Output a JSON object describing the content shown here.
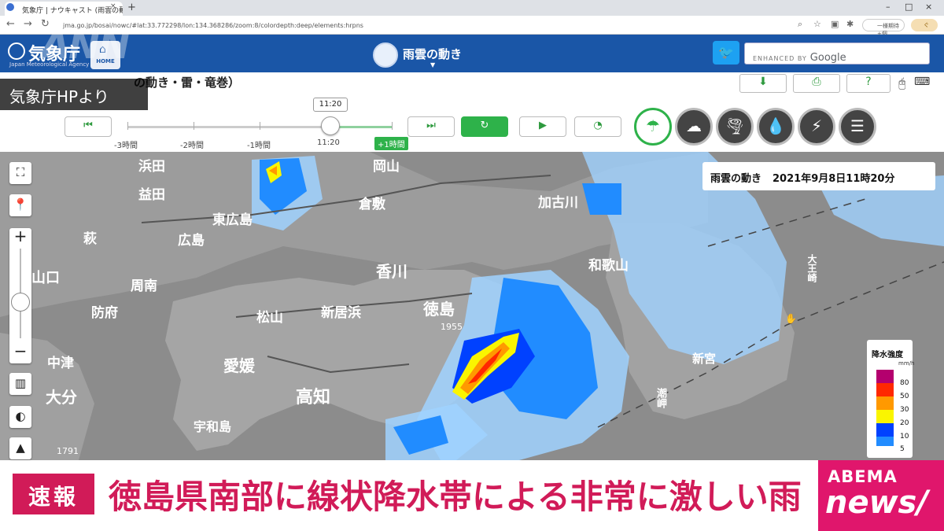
{
  "browser": {
    "tab_title": "気象庁 | ナウキャスト (雨雲の動き",
    "tab_close": "×",
    "new_tab": "+",
    "url": "jma.go.jp/bosai/nowc/#lat:33.772298/lon:134.368286/zoom:8/colordepth:deep/elements:hrpns",
    "window_controls": [
      "–",
      "□",
      "×"
    ],
    "ext1_label": "一様期待+個",
    "ext2_label": "ぐ"
  },
  "jma": {
    "title": "気象庁",
    "subtitle": "Japan Meteorological Agency",
    "home_label": "HOME",
    "nowcast_title": "雨雲の動き",
    "nowcast_caret": "▼",
    "search_enhanced": "ENHANCED BY",
    "search_google": "Google"
  },
  "controls": {
    "heading": "の動き・雷・竜巻）",
    "current_time": "11:20",
    "time_labels": [
      "-3時間",
      "-2時間",
      "-1時間",
      "11:20",
      "+1時間"
    ],
    "buttons": {
      "first": "⏮",
      "last": "⏭",
      "refresh": "↻",
      "play": "▶",
      "speed": "◔",
      "download": "⬇",
      "print": "⎙",
      "help": "?"
    }
  },
  "layers": [
    "雨雲",
    "雷",
    "竜巻",
    "降水",
    "雷活動",
    "強風"
  ],
  "map": {
    "timestamp_title": "雨雲の動き",
    "timestamp_value": "2021年9月8日11時20分",
    "labels": [
      {
        "text": "浜田"
      },
      {
        "text": "岡山"
      },
      {
        "text": "倉敷"
      },
      {
        "text": "加古川"
      },
      {
        "text": "益田"
      },
      {
        "text": "東広島"
      },
      {
        "text": "萩"
      },
      {
        "text": "広島"
      },
      {
        "text": "山口"
      },
      {
        "text": "周南"
      },
      {
        "text": "防府"
      },
      {
        "text": "香川"
      },
      {
        "text": "徳島"
      },
      {
        "text": "和歌山"
      },
      {
        "text": "松山"
      },
      {
        "text": "新居浜"
      },
      {
        "text": "愛媛"
      },
      {
        "text": "高知"
      },
      {
        "text": "中津"
      },
      {
        "text": "大分"
      },
      {
        "text": "宇和島"
      },
      {
        "text": "大王崎"
      },
      {
        "text": "新宮"
      },
      {
        "text": "潮岬"
      }
    ],
    "peaks": [
      "1955",
      "1791"
    ]
  },
  "legend": {
    "title": "降水強度",
    "unit": "mm/h",
    "levels": [
      {
        "label": "80",
        "color": "#b4006e"
      },
      {
        "label": "50",
        "color": "#ff2800"
      },
      {
        "label": "30",
        "color": "#ff9900"
      },
      {
        "label": "20",
        "color": "#faf500"
      },
      {
        "label": "10",
        "color": "#0041ff"
      },
      {
        "label": "5",
        "color": "#218cff"
      }
    ]
  },
  "broadcast": {
    "watermark": "ANN",
    "source_tag": "気象庁HPより",
    "flash_label": "速報",
    "headline": "徳島県南部に線状降水帯による非常に激しい雨",
    "logo_top": "ABEMA",
    "logo_bottom": "news/"
  }
}
